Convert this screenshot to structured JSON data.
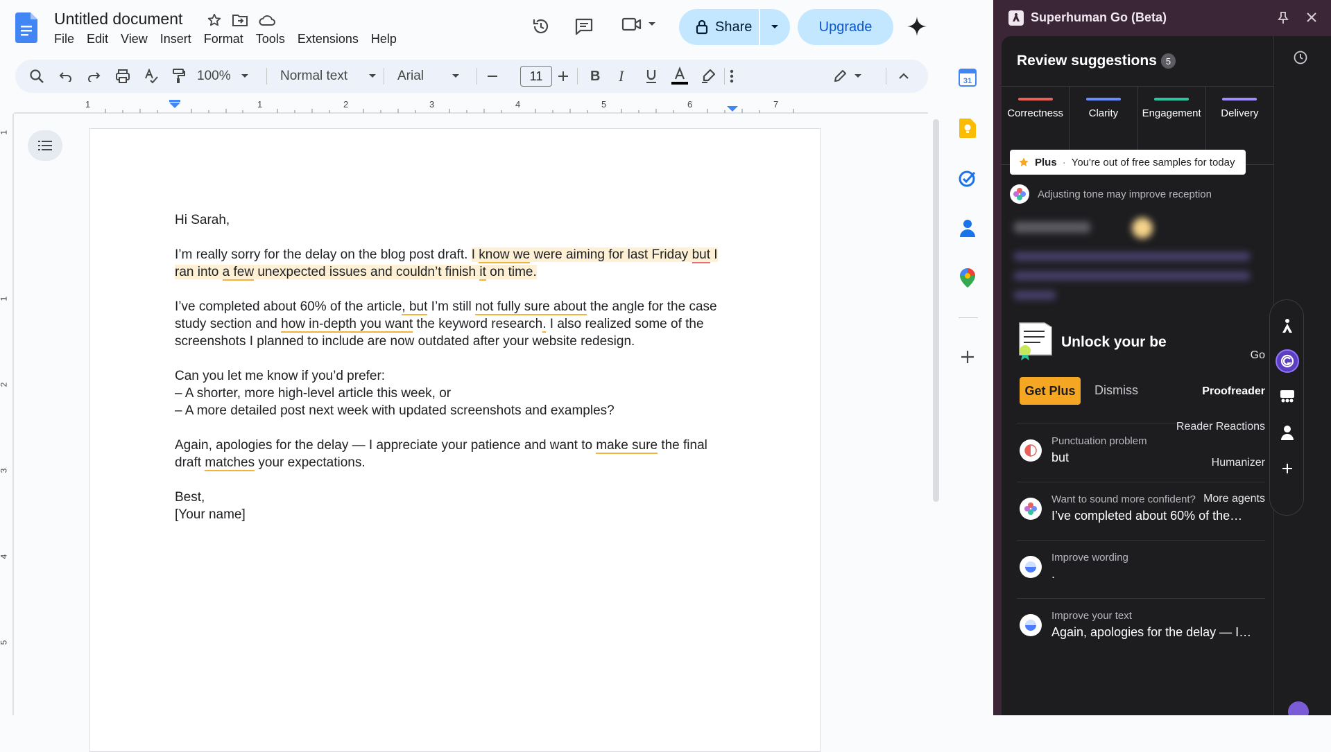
{
  "docs": {
    "title": "Untitled document",
    "menu": [
      "File",
      "Edit",
      "View",
      "Insert",
      "Format",
      "Tools",
      "Extensions",
      "Help"
    ],
    "share_label": "Share",
    "upgrade_label": "Upgrade",
    "toolbar": {
      "zoom": "100%",
      "style": "Normal text",
      "font": "Arial",
      "font_size": "11"
    },
    "ruler_numbers": [
      "1",
      "1",
      "2",
      "3",
      "4",
      "5",
      "6",
      "7"
    ],
    "vruler_numbers": [
      "1",
      "1",
      "2",
      "3",
      "4",
      "5"
    ],
    "body": {
      "greeting": "Hi Sarah,",
      "p1": {
        "a": "I’m really sorry for the delay on the blog post draft. ",
        "b": "I ",
        "c": "know we",
        "d": " were aiming for last Friday ",
        "e": "but",
        "f": " I ran into ",
        "g": "a few",
        "h": " unexpected issues and couldn’t finish ",
        "i": "it",
        "j": " on time."
      },
      "p2": {
        "a": "I’ve completed about 60% of the article",
        "b": ", but",
        "c": " I’m still ",
        "d": "not fully sure about",
        "e": " the angle for the case study section and ",
        "f": "how in-depth you want",
        "g": " the keyword research",
        "h": ".",
        "i": " I also realized some of the screenshots I planned to include are now outdated after your website redesign."
      },
      "p3_lines": [
        "Can you let me know if you’d prefer:",
        "– A shorter, more high-level article this week, or",
        "– A more detailed post next week with updated screenshots and examples?"
      ],
      "p4": {
        "a": "Again, apologies for the delay — I appreciate your patience and want to ",
        "b": "make sure",
        "c": " the final draft ",
        "d": "matches",
        "e": " your expectations."
      },
      "closing": [
        "Best,",
        "[Your name]"
      ]
    }
  },
  "panel": {
    "title": "Superhuman Go (Beta)",
    "review_title": "Review suggestions",
    "count": "5",
    "tabs": [
      {
        "label": "Correctness",
        "color": "#e8615a"
      },
      {
        "label": "Clarity",
        "color": "#6b8cff"
      },
      {
        "label": "Engagement",
        "color": "#2fc4a0"
      },
      {
        "label": "Delivery",
        "color": "#9f8cff"
      }
    ],
    "plus_label": "Plus",
    "plus_text": "You're out of free samples for today",
    "tone_text": "Adjusting tone may improve reception",
    "unlock_title": "Unlock your be",
    "get_plus": "Get Plus",
    "dismiss": "Dismiss",
    "agents": [
      "Go",
      "Proofreader",
      "Reader Reactions",
      "Humanizer",
      "More agents"
    ],
    "suggestions": [
      {
        "type": "Punctuation problem",
        "text": "but"
      },
      {
        "type": "Want to sound more confident?",
        "text": "I’ve completed about 60% of the…"
      },
      {
        "type": "Improve wording",
        "text": "."
      },
      {
        "type": "Improve your text",
        "text": "Again, apologies for the delay — I…"
      }
    ]
  }
}
